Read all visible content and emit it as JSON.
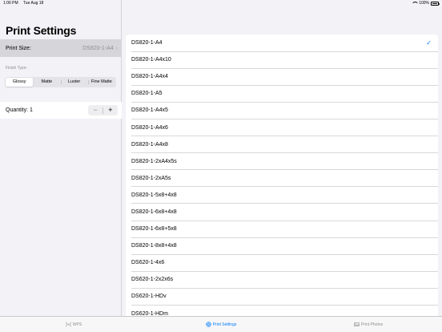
{
  "status_bar": {
    "time": "1:06 PM",
    "date": "Tue Aug 18",
    "battery": "100%"
  },
  "settings": {
    "title": "Print Settings",
    "print_size_label": "Print Size:",
    "print_size_value": "DS820-1-A4",
    "finish_type_label": "Finish Type:",
    "finish_options": [
      "Glossy",
      "Matte",
      "Luster",
      "Fine Matte"
    ],
    "finish_selected": "Glossy",
    "quantity_label": "Quantity: 1",
    "quantity": 1,
    "stepper_minus": "−",
    "stepper_plus": "+"
  },
  "size_list": {
    "selected": "DS820-1-A4",
    "items": [
      "DS820-1-A4",
      "DS820-1-A4x10",
      "DS820-1-A4x4",
      "DS820-1-A5",
      "DS820-1-A4x5",
      "DS820-1-A4x6",
      "DS820-1-A4x8",
      "DS820-1-2xA4x5s",
      "DS820-1-2xA5s",
      "DS820-1-5x8+4x8",
      "DS820-1-6x8+4x8",
      "DS820-1-6x8+5x8",
      "DS820-1-8x8+4x8",
      "DS620-1-4x6",
      "DS620-1-2x2x6s",
      "DS620-1-HDv",
      "DS620-1-HDm"
    ],
    "check_mark": "✓"
  },
  "tab_bar": {
    "tabs": [
      {
        "label": "WPS",
        "icon": "wps-signal-icon",
        "active": false
      },
      {
        "label": "Print Settings",
        "icon": "settings-gear-icon",
        "active": true
      },
      {
        "label": "Print Photos",
        "icon": "photo-icon",
        "active": false
      }
    ],
    "accent_color": "#007aff",
    "inactive_color": "#8e8e93"
  }
}
